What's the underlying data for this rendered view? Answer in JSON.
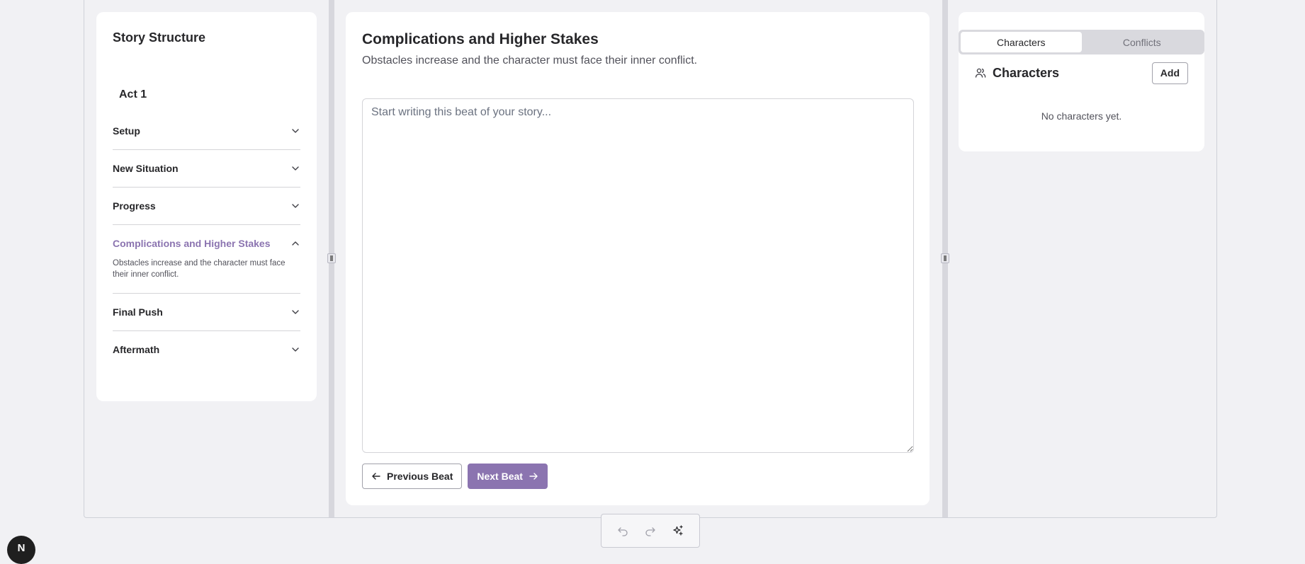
{
  "outline": {
    "title": "Story Structure",
    "act": "Act 1",
    "beats": [
      {
        "label": "Setup",
        "expanded": false
      },
      {
        "label": "New Situation",
        "expanded": false
      },
      {
        "label": "Progress",
        "expanded": false
      },
      {
        "label": "Complications and Higher Stakes",
        "expanded": true,
        "description": "Obstacles increase and the character must face their inner conflict."
      },
      {
        "label": "Final Push",
        "expanded": false
      },
      {
        "label": "Aftermath",
        "expanded": false
      }
    ]
  },
  "editor": {
    "title": "Complications and Higher Stakes",
    "subtitle": "Obstacles increase and the character must face their inner conflict.",
    "placeholder": "Start writing this beat of your story...",
    "value": "",
    "prev_label": "Previous Beat",
    "next_label": "Next Beat"
  },
  "sidebar": {
    "tabs": [
      {
        "label": "Characters",
        "active": true
      },
      {
        "label": "Conflicts",
        "active": false
      }
    ],
    "section_title": "Characters",
    "add_label": "Add",
    "empty_text": "No characters yet."
  },
  "toolbar": {
    "icons": [
      "undo-icon",
      "redo-icon",
      "sparkles-icon"
    ]
  },
  "badge": {
    "letter": "N"
  },
  "colors": {
    "accent": "#8b74b0",
    "background": "#f1f1f4",
    "card": "#ffffff",
    "text": "#27272a"
  }
}
